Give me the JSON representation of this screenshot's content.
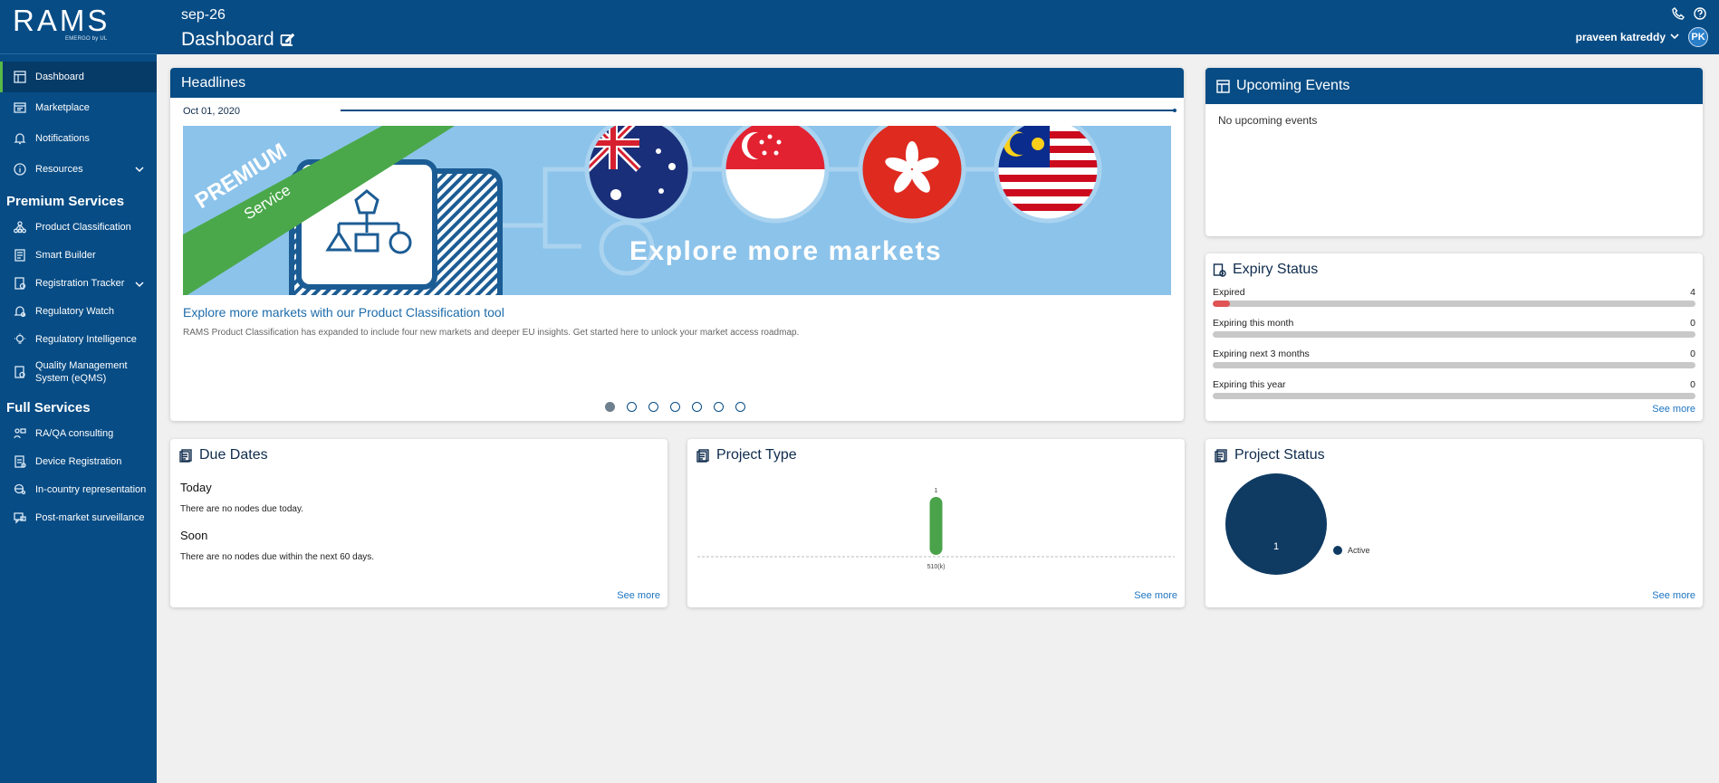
{
  "brand": {
    "logo": "RAMS",
    "tagline": "EMERGO by UL"
  },
  "sidebar": {
    "items": [
      {
        "label": "Dashboard",
        "icon": "dashboard-icon"
      },
      {
        "label": "Marketplace",
        "icon": "marketplace-icon"
      },
      {
        "label": "Notifications",
        "icon": "bell-icon"
      },
      {
        "label": "Resources",
        "icon": "info-icon"
      }
    ],
    "premium_title": "Premium Services",
    "premium": [
      {
        "label": "Product Classification"
      },
      {
        "label": "Smart Builder"
      },
      {
        "label": "Registration Tracker"
      },
      {
        "label": "Regulatory Watch"
      },
      {
        "label": "Regulatory Intelligence"
      },
      {
        "label": "Quality Management System (eQMS)"
      }
    ],
    "full_title": "Full Services",
    "full": [
      {
        "label": "RA/QA consulting"
      },
      {
        "label": "Device Registration"
      },
      {
        "label": "In-country representation"
      },
      {
        "label": "Post-market surveillance"
      }
    ]
  },
  "header": {
    "subtitle": "sep-26",
    "title": "Dashboard",
    "user": "praveen katreddy",
    "avatar": "PK"
  },
  "headlines": {
    "title": "Headlines",
    "date": "Oct 01, 2020",
    "banner_badge_1": "PREMIUM",
    "banner_badge_2": "Service",
    "banner_text": "Explore more markets",
    "headline": "Explore more markets with our Product Classification tool",
    "body": "RAMS Product Classification has expanded to include four new markets and deeper EU insights. Get started here to unlock your market access roadmap.",
    "slides": 7,
    "active_slide": 0
  },
  "events": {
    "title": "Upcoming Events",
    "empty": "No upcoming events"
  },
  "expiry": {
    "title": "Expiry Status",
    "rows": [
      {
        "label": "Expired",
        "value": "4",
        "fraction": 0.035
      },
      {
        "label": "Expiring this month",
        "value": "0",
        "fraction": 0
      },
      {
        "label": "Expiring next 3 months",
        "value": "0",
        "fraction": 0
      },
      {
        "label": "Expiring this year",
        "value": "0",
        "fraction": 0
      }
    ],
    "see_more": "See more"
  },
  "due_dates": {
    "title": "Due Dates",
    "today_h": "Today",
    "today_t": "There are no nodes due today.",
    "soon_h": "Soon",
    "soon_t": "There are no nodes due within the next 60 days.",
    "see_more": "See more"
  },
  "project_type": {
    "title": "Project Type",
    "see_more": "See more"
  },
  "project_status": {
    "title": "Project Status",
    "see_more": "See more"
  },
  "colors": {
    "navy": "#074c85",
    "accent_green": "#58b947",
    "bar_green": "#4aa34a",
    "pie_navy": "#0f3b63",
    "expired_red": "#e05453"
  },
  "chart_data": [
    {
      "type": "bar",
      "categories": [
        "510(k)"
      ],
      "values": [
        1
      ],
      "data_labels": [
        "1"
      ]
    },
    {
      "type": "pie",
      "categories": [
        "Active"
      ],
      "values": [
        1
      ],
      "data_labels": [
        "1"
      ],
      "legend": "right"
    }
  ]
}
